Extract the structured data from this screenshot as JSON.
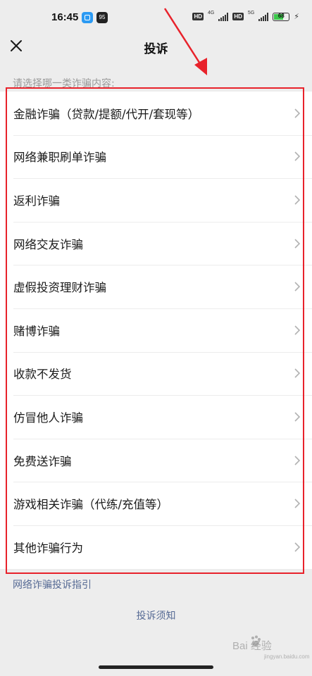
{
  "status_bar": {
    "time": "16:45",
    "app_badge_text": "95",
    "hd1": "HD",
    "net1": "4G",
    "hd2": "HD",
    "net2": "5G",
    "battery_level": "68"
  },
  "nav": {
    "title": "投诉"
  },
  "hint": "请选择哪一类诈骗内容:",
  "categories": [
    "金融诈骗（贷款/提额/代开/套现等）",
    "网络兼职刷单诈骗",
    "返利诈骗",
    "网络交友诈骗",
    "虚假投资理财诈骗",
    "赌博诈骗",
    "收款不发货",
    "仿冒他人诈骗",
    "免费送诈骗",
    "游戏相关诈骗（代练/充值等）",
    "其他诈骗行为"
  ],
  "links": {
    "guide": "网络诈骗投诉指引",
    "notice": "投诉须知"
  },
  "watermark": {
    "text": "Bai 经验",
    "sub": "jingyan.baidu.com"
  },
  "colors": {
    "annotation_red": "#e8222b",
    "link_blue": "#576b95",
    "page_background": "#ededed"
  }
}
